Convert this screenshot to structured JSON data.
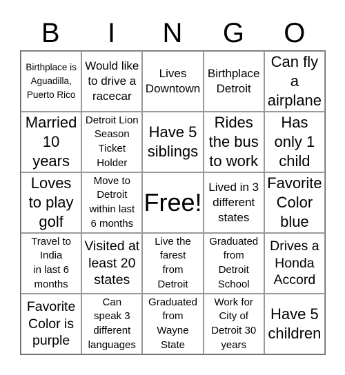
{
  "header": [
    "B",
    "I",
    "N",
    "G",
    "O"
  ],
  "cells": [
    "Birthplace is\nAguadilla,\nPuerto Rico",
    "Would like\nto drive a\nracecar",
    "Lives\nDowntown",
    "Birthplace\nDetroit",
    "Can fly\na\nairplane",
    "Married\n10\nyears",
    "Detroit Lion\nSeason\nTicket\nHolder",
    "Have 5\nsiblings",
    "Rides\nthe bus\nto work",
    "Has\nonly 1\nchild",
    "Loves\nto play\ngolf",
    "Move to\nDetroit\nwithin last\n6 months",
    "Free!",
    "Lived in 3\ndifferent\nstates",
    "Favorite\nColor\nblue",
    "Travel to\nIndia\nin last 6\nmonths",
    "Visited at\nleast 20\nstates",
    "Live the\nfarest\nfrom\nDetroit",
    "Graduated\nfrom\nDetroit\nSchool",
    "Drives a\nHonda\nAccord",
    "Favorite\nColor is\npurple",
    "Can\nspeak 3\ndifferent\nlanguages",
    "Graduated\nfrom\nWayne\nState",
    "Work for\nCity of\nDetroit 30\nyears",
    "Have 5\nchildren"
  ]
}
